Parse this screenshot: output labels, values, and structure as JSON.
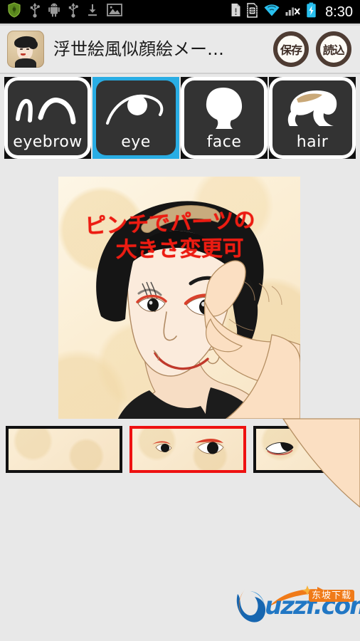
{
  "statusbar": {
    "time": "8:30",
    "left_icons": [
      {
        "name": "shield-icon",
        "label": "security-shield"
      },
      {
        "name": "usb-icon",
        "label": "usb"
      },
      {
        "name": "android-robot-icon",
        "label": "android"
      },
      {
        "name": "usb-debug-icon",
        "label": "usb-debugging"
      },
      {
        "name": "download-icon",
        "label": "download"
      },
      {
        "name": "image-icon",
        "label": "screenshot"
      }
    ],
    "right_icons": [
      {
        "name": "document-alert-icon",
        "label": "document-warning"
      },
      {
        "name": "sim-error-icon",
        "label": "sim-card"
      },
      {
        "name": "wifi-icon",
        "label": "wifi"
      },
      {
        "name": "signal-none-icon",
        "label": "no-signal"
      },
      {
        "name": "battery-charging-icon",
        "label": "battery-charging"
      }
    ]
  },
  "titlebar": {
    "app_title": "浮世絵風似顔絵メー…",
    "save_label": "保存",
    "load_label": "読込"
  },
  "tabs": [
    {
      "label": "eyebrow",
      "selected": false
    },
    {
      "label": "eye",
      "selected": true
    },
    {
      "label": "face",
      "selected": false
    },
    {
      "label": "hair",
      "selected": false
    }
  ],
  "canvas": {
    "annotation_line1": "ピンチでパーツの",
    "annotation_line2": "大きさ変更可"
  },
  "thumbnails": [
    {
      "name": "thumb-eye-none",
      "selected": false,
      "content": "empty"
    },
    {
      "name": "thumb-eye-style-1",
      "selected": true,
      "content": "eyes-red-liner"
    },
    {
      "name": "thumb-eye-style-2",
      "selected": false,
      "content": "eyes-oval"
    }
  ],
  "watermark": {
    "site": "uzzf.com",
    "cn_label": "东坡下载"
  },
  "colors": {
    "accent_blue": "#29ade4",
    "selected_red": "#ee1111",
    "annotation_red": "#ec1c12",
    "page_bg": "#e8e8e8",
    "titlebar_bg": "#e9e9e9",
    "tab_dark": "#333333",
    "button_ring": "#4e3c33",
    "watermark_blue": "#2177c4",
    "watermark_orange": "#f07a18"
  }
}
